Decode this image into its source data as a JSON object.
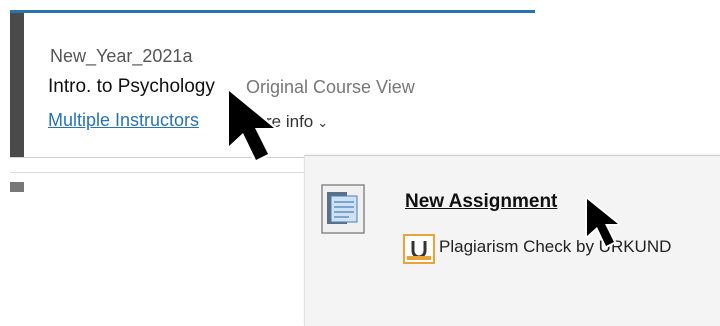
{
  "course": {
    "code": "New_Year_2021a",
    "name": "Intro. to Psychology",
    "view": "Original Course View",
    "instructors_link": "Multiple Instructors",
    "more_info": "re info"
  },
  "menu": {
    "item_title": "New Assignment",
    "plagiarism_label": "Plagiarism Check by URKUND"
  },
  "colors": {
    "link": "#2a73b3",
    "accent_bar": "#4a4a4a",
    "card_top_border": "#2a73b3",
    "urkund_orange": "#e8a33a"
  },
  "icons": {
    "assignment": "assignment-icon",
    "urkund": "urkund-icon",
    "chevron": "chevron-down-icon",
    "cursor": "mouse-pointer-icon"
  }
}
